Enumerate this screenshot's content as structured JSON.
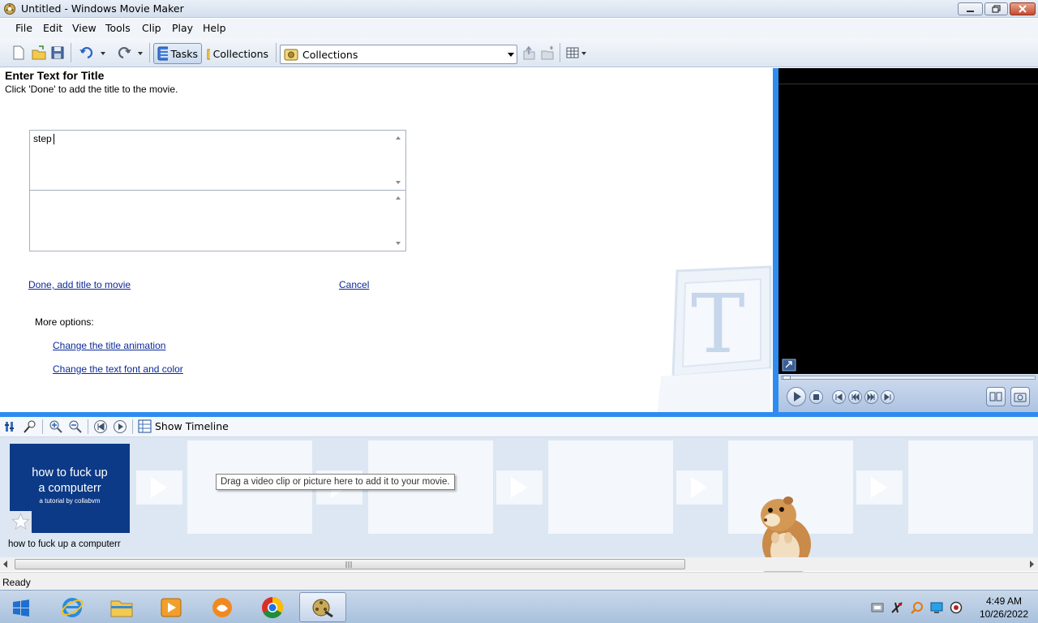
{
  "window": {
    "title": "Untitled - Windows Movie Maker"
  },
  "menu": [
    "File",
    "Edit",
    "View",
    "Tools",
    "Clip",
    "Play",
    "Help"
  ],
  "toolbar": {
    "tasks_label": "Tasks",
    "collections_label": "Collections",
    "collections_select": "Collections"
  },
  "task": {
    "heading": "Enter Text for Title",
    "subheading": "Click 'Done' to add the title to the movie.",
    "title_text": "step ",
    "subtitle_text": "",
    "done_link": "Done, add title to movie",
    "cancel_link": "Cancel",
    "more_options": "More options:",
    "change_animation": "Change the title animation",
    "change_font": "Change the text font and color"
  },
  "storyboard": {
    "show_timeline": "Show Timeline",
    "drag_hint": "Drag a video clip or picture here to add it to your movie.",
    "clip": {
      "line1": "how to fuck up",
      "line2": "a computerr",
      "line3": "a tutorial by collabvm",
      "caption": "how to fuck up a computerr"
    }
  },
  "status": {
    "text": "Ready"
  },
  "taskbar": {
    "apps": [
      "start-icon",
      "internet-explorer-icon",
      "file-explorer-icon",
      "media-player-icon",
      "uc-browser-icon",
      "chrome-icon",
      "movie-maker-icon"
    ],
    "time": "4:49 AM",
    "date": "10/26/2022"
  },
  "colors": {
    "accent": "#2e8cf0",
    "link": "#0a2a9a",
    "clip_bg": "#0d3a86",
    "storyboard_bg": "#dce7f3"
  }
}
